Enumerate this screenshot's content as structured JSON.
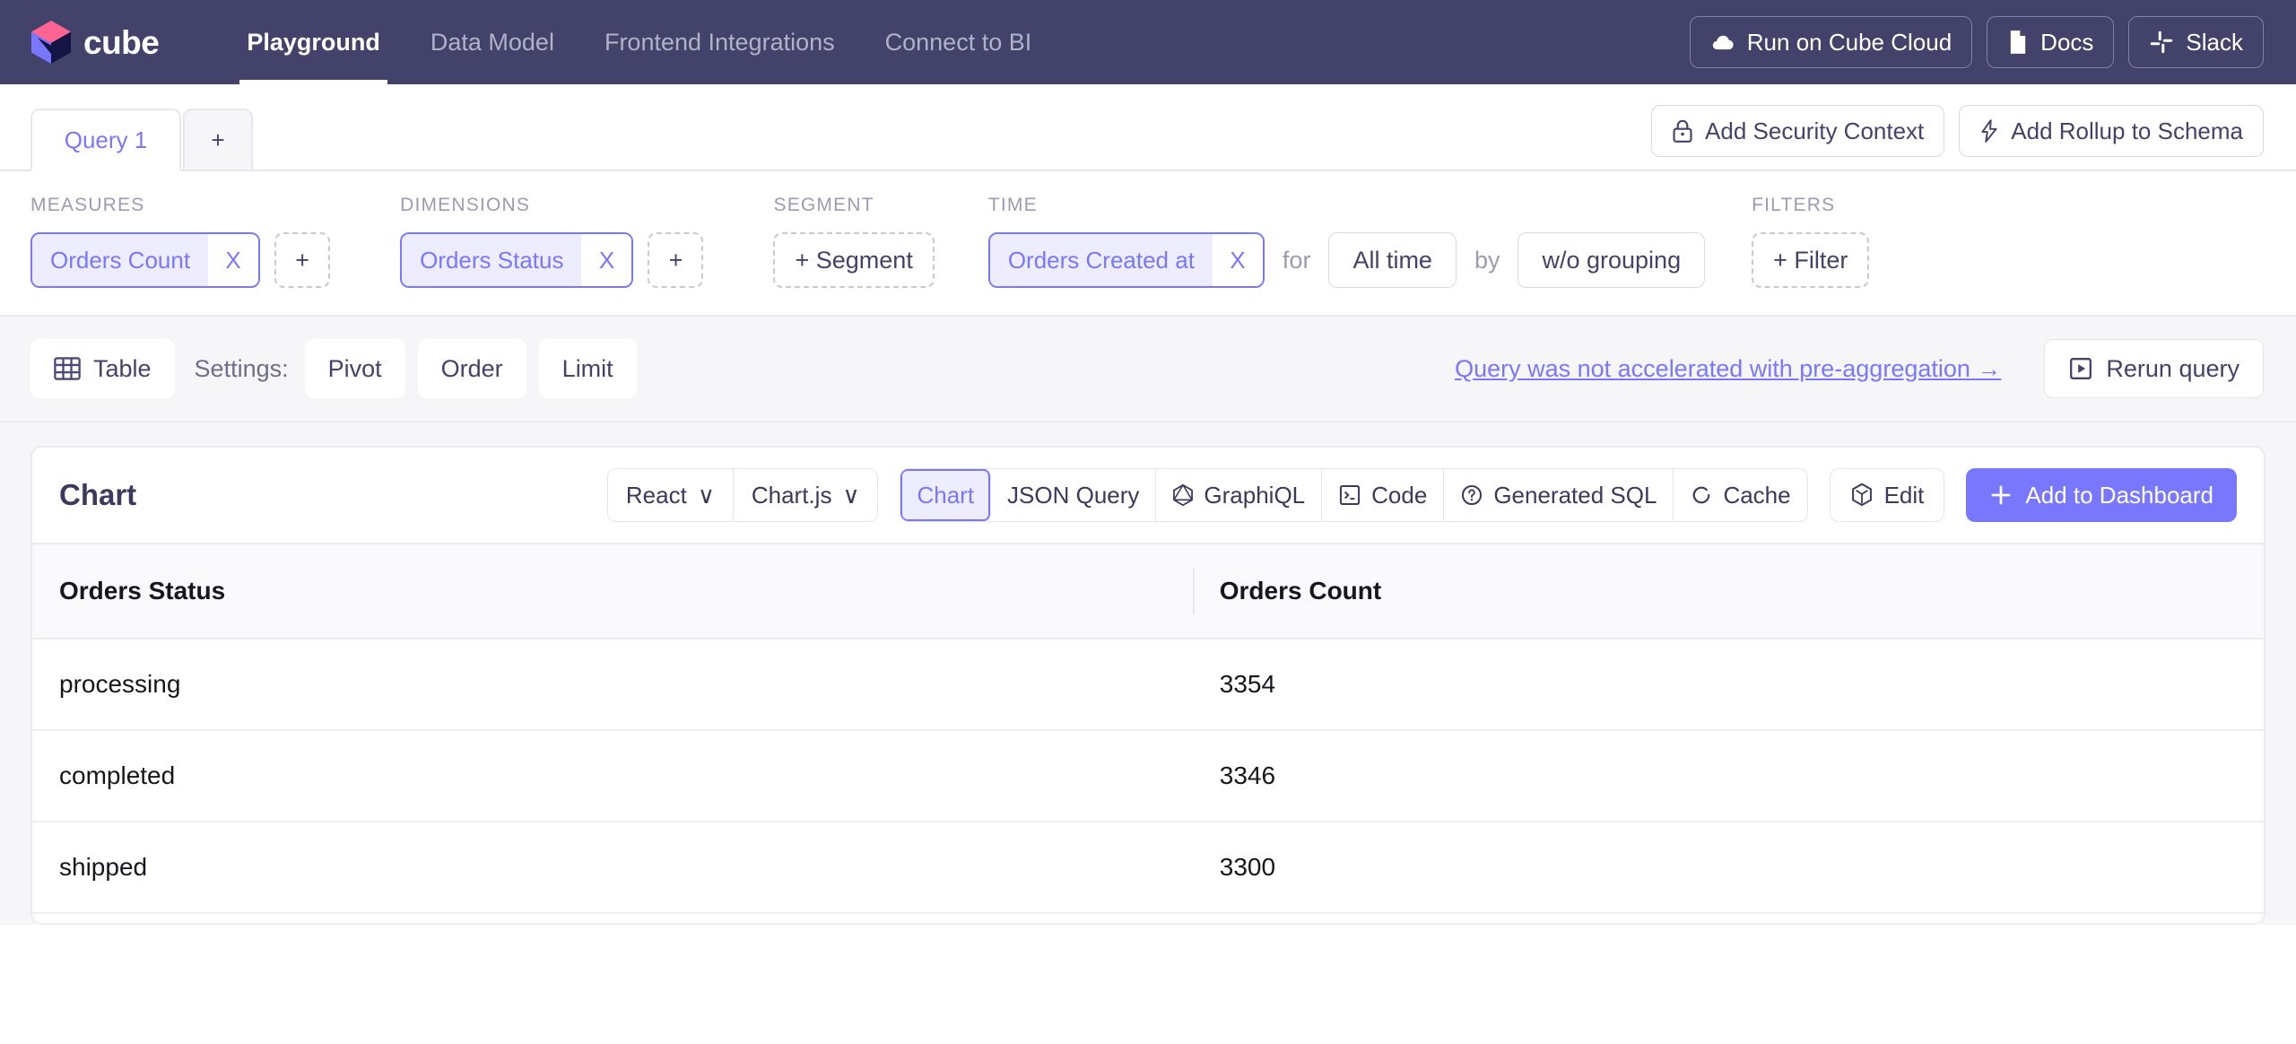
{
  "navbar": {
    "brand": "cube",
    "links": [
      {
        "label": "Playground",
        "active": true
      },
      {
        "label": "Data Model",
        "active": false
      },
      {
        "label": "Frontend Integrations",
        "active": false
      },
      {
        "label": "Connect to BI",
        "active": false
      }
    ],
    "actions": [
      {
        "label": "Run on Cube Cloud",
        "icon": "cloud-icon"
      },
      {
        "label": "Docs",
        "icon": "document-icon"
      },
      {
        "label": "Slack",
        "icon": "slack-icon"
      }
    ],
    "background": "#43426B"
  },
  "tabbar": {
    "tabs": [
      {
        "label": "Query 1",
        "active": true
      }
    ],
    "add_tab_label": "+",
    "actions": [
      {
        "label": "Add Security Context",
        "icon": "lock-icon"
      },
      {
        "label": "Add Rollup to Schema",
        "icon": "lightning-icon"
      }
    ]
  },
  "builder": {
    "measures": {
      "label": "MEASURES",
      "chips": [
        {
          "name": "Orders Count",
          "remove": "X"
        }
      ],
      "add": "+"
    },
    "dimensions": {
      "label": "DIMENSIONS",
      "chips": [
        {
          "name": "Orders Status",
          "remove": "X"
        }
      ],
      "add": "+"
    },
    "segment": {
      "label": "SEGMENT",
      "add": "+ Segment"
    },
    "time": {
      "label": "TIME",
      "chips": [
        {
          "name": "Orders Created at",
          "remove": "X"
        }
      ],
      "for_label": "for",
      "date_range": "All time",
      "by_label": "by",
      "granularity": "w/o grouping"
    },
    "filters": {
      "label": "FILTERS",
      "add": "+ Filter"
    }
  },
  "toolbar": {
    "view_button": "Table",
    "view_icon": "table-grid-icon",
    "settings_label": "Settings:",
    "settings": [
      "Pivot",
      "Order",
      "Limit"
    ],
    "accel_link": "Query was not accelerated with pre-aggregation →",
    "rerun_label": "Rerun query",
    "rerun_icon": "play-box-icon"
  },
  "card": {
    "title": "Chart",
    "framework_select": {
      "value": "React",
      "caret": "∨"
    },
    "charting_select": {
      "value": "Chart.js",
      "caret": "∨"
    },
    "tabs": [
      {
        "label": "Chart",
        "icon": null,
        "active": true
      },
      {
        "label": "JSON Query",
        "icon": null,
        "active": false
      },
      {
        "label": "GraphiQL",
        "icon": "graphql-icon",
        "active": false
      },
      {
        "label": "Code",
        "icon": "terminal-icon",
        "active": false
      },
      {
        "label": "Generated SQL",
        "icon": "question-circle-icon",
        "active": false
      },
      {
        "label": "Cache",
        "icon": "refresh-icon",
        "active": false
      }
    ],
    "edit_button": {
      "label": "Edit",
      "icon": "cube-icon"
    },
    "add_to_dashboard": {
      "label": "Add to Dashboard",
      "icon": "plus-icon",
      "color": "#7A77FF"
    }
  },
  "chart_data": {
    "type": "table",
    "title": "Chart",
    "columns": [
      "Orders Status",
      "Orders Count"
    ],
    "categories": [
      "processing",
      "completed",
      "shipped"
    ],
    "values": [
      3354,
      3346,
      3300
    ],
    "rows": [
      {
        "status": "processing",
        "count": "3354"
      },
      {
        "status": "completed",
        "count": "3346"
      },
      {
        "status": "shipped",
        "count": "3300"
      }
    ],
    "xlabel": "Orders Status",
    "ylabel": "Orders Count"
  }
}
